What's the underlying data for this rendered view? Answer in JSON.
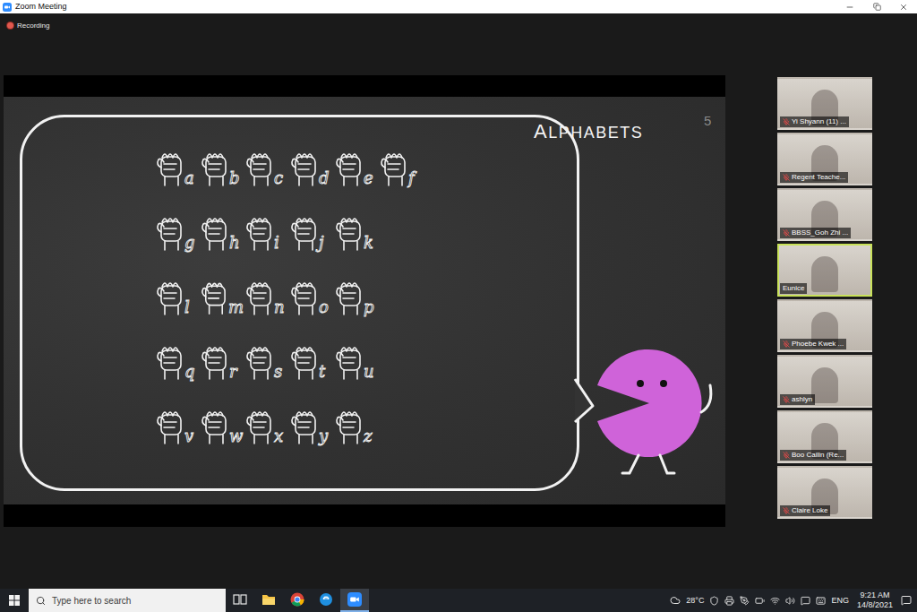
{
  "window": {
    "title": "Zoom Meeting"
  },
  "recording": {
    "label": "Recording"
  },
  "slide": {
    "title": "ALPHABETS",
    "page": "5",
    "rows": [
      [
        "a",
        "b",
        "c",
        "d",
        "e",
        "f"
      ],
      [
        "g",
        "h",
        "i",
        "j",
        "k"
      ],
      [
        "l",
        "m",
        "n",
        "o",
        "p"
      ],
      [
        "q",
        "r",
        "s",
        "t",
        "u"
      ],
      [
        "v",
        "w",
        "x",
        "y",
        "z"
      ]
    ]
  },
  "participants": [
    {
      "name": "Yi Shyann (11) ...",
      "muted": true,
      "speaking": false
    },
    {
      "name": "Regent Teache...",
      "muted": true,
      "speaking": false
    },
    {
      "name": "BBSS_Goh Zhi ...",
      "muted": true,
      "speaking": false
    },
    {
      "name": "Eunice",
      "muted": false,
      "speaking": true
    },
    {
      "name": "Phoebe Kwek ...",
      "muted": true,
      "speaking": false
    },
    {
      "name": "ashlyn",
      "muted": true,
      "speaking": false
    },
    {
      "name": "Boo Cailin (Re...",
      "muted": true,
      "speaking": false
    },
    {
      "name": "Claire Loke",
      "muted": true,
      "speaking": false
    }
  ],
  "taskbar": {
    "search": {
      "placeholder": "Type here to search"
    },
    "apps": [
      {
        "kind": "taskview",
        "active": false
      },
      {
        "kind": "explorer",
        "active": false
      },
      {
        "kind": "chrome",
        "active": false
      },
      {
        "kind": "edge",
        "active": false
      },
      {
        "kind": "zoom",
        "active": true
      }
    ],
    "weather": "28°C",
    "language": "ENG",
    "time": "9:21 AM",
    "date": "14/8/2021"
  }
}
